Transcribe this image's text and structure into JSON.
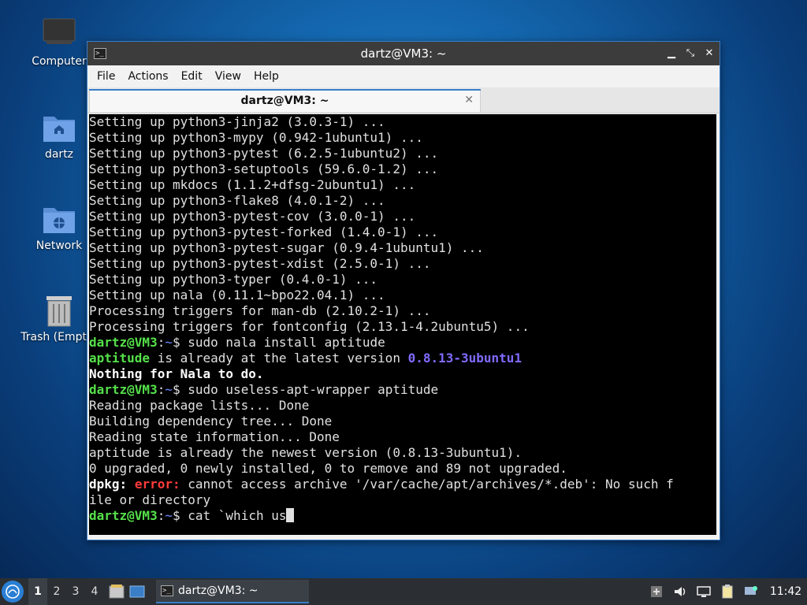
{
  "desktop": {
    "icons": [
      {
        "label": "Computer"
      },
      {
        "label": "dartz"
      },
      {
        "label": "Network"
      },
      {
        "label": "Trash (Empty)"
      }
    ]
  },
  "window": {
    "title": "dartz@VM3: ~",
    "menu": [
      "File",
      "Actions",
      "Edit",
      "View",
      "Help"
    ],
    "tab_label": "dartz@VM3: ~",
    "tab_close": "✕",
    "controls": {
      "minimize": "▁",
      "maximize": "⤡",
      "close": "✕"
    }
  },
  "terminal": {
    "lines": [
      "Setting up python3-jinja2 (3.0.3-1) ...",
      "Setting up python3-mypy (0.942-1ubuntu1) ...",
      "Setting up python3-pytest (6.2.5-1ubuntu2) ...",
      "Setting up python3-setuptools (59.6.0-1.2) ...",
      "Setting up mkdocs (1.1.2+dfsg-2ubuntu1) ...",
      "Setting up python3-flake8 (4.0.1-2) ...",
      "Setting up python3-pytest-cov (3.0.0-1) ...",
      "Setting up python3-pytest-forked (1.4.0-1) ...",
      "Setting up python3-pytest-sugar (0.9.4-1ubuntu1) ...",
      "Setting up python3-pytest-xdist (2.5.0-1) ...",
      "Setting up python3-typer (0.4.0-1) ...",
      "Setting up nala (0.11.1~bpo22.04.1) ...",
      "Processing triggers for man-db (2.10.2-1) ...",
      "Processing triggers for fontconfig (2.13.1-4.2ubuntu5) ..."
    ],
    "prompt_user": "dartz@VM3",
    "prompt_sep": ":",
    "prompt_dir": "~",
    "prompt_sym": "$",
    "cmd1": " sudo nala install aptitude",
    "nala_pkg": "aptitude",
    "nala_msg": " is already at the latest version ",
    "nala_ver": "0.8.13-3ubuntu1",
    "nala_nothing": "Nothing for Nala to do.",
    "cmd2": " sudo useless-apt-wrapper aptitude",
    "apt_lines": [
      "Reading package lists... Done",
      "Building dependency tree... Done",
      "Reading state information... Done",
      "aptitude is already the newest version (0.8.13-3ubuntu1).",
      "0 upgraded, 0 newly installed, 0 to remove and 89 not upgraded."
    ],
    "dpkg_label": "dpkg:",
    "error_label": "error:",
    "error_msg": " cannot access archive '/var/cache/apt/archives/*.deb': No such f",
    "error_msg2": "ile or directory",
    "cmd3": " cat `which us"
  },
  "taskbar": {
    "workspaces": [
      "1",
      "2",
      "3",
      "4"
    ],
    "task_label": "dartz@VM3: ~",
    "clock": "11:42"
  }
}
